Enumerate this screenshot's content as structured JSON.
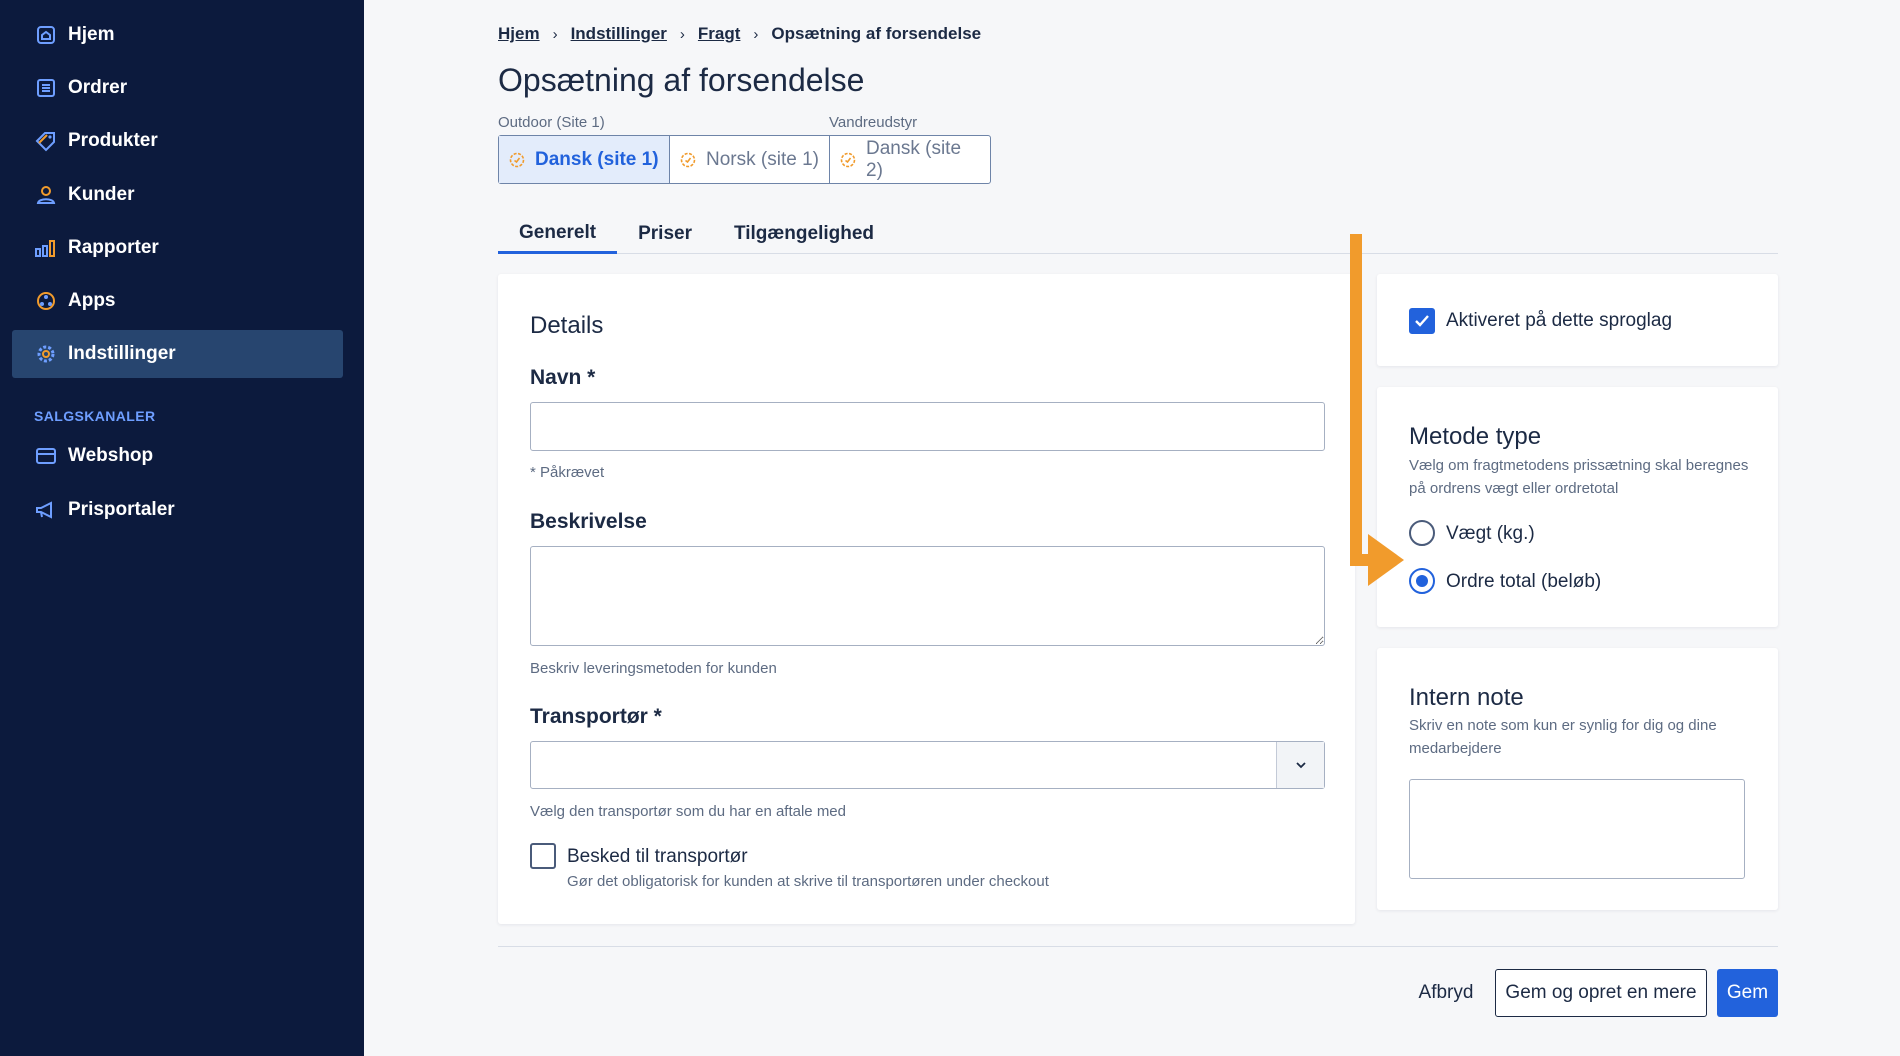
{
  "sidebar": {
    "items": [
      {
        "label": "Hjem",
        "icon": "home-icon"
      },
      {
        "label": "Ordrer",
        "icon": "orders-icon"
      },
      {
        "label": "Produkter",
        "icon": "tag-icon"
      },
      {
        "label": "Kunder",
        "icon": "user-icon"
      },
      {
        "label": "Rapporter",
        "icon": "bar-chart-icon"
      },
      {
        "label": "Apps",
        "icon": "apps-icon"
      },
      {
        "label": "Indstillinger",
        "icon": "gear-icon",
        "active": true
      }
    ],
    "section_label": "SALGSKANALER",
    "channels": [
      {
        "label": "Webshop",
        "icon": "webshop-icon"
      },
      {
        "label": "Prisportaler",
        "icon": "megaphone-icon"
      }
    ]
  },
  "breadcrumb": {
    "items": [
      "Hjem",
      "Indstillinger",
      "Fragt"
    ],
    "current": "Opsætning af forsendelse"
  },
  "page": {
    "title": "Opsætning af forsendelse"
  },
  "sites": {
    "labels": [
      "Outdoor (Site 1)",
      "Vandreudstyr"
    ],
    "tabs": [
      {
        "label": "Dansk (site 1)",
        "active": true
      },
      {
        "label": "Norsk (site 1)",
        "active": false
      },
      {
        "label": "Dansk (site 2)",
        "active": false
      }
    ]
  },
  "section_tabs": [
    {
      "label": "Generelt",
      "active": true
    },
    {
      "label": "Priser",
      "active": false
    },
    {
      "label": "Tilgængelighed",
      "active": false
    }
  ],
  "details": {
    "title": "Details",
    "name_label": "Navn *",
    "name_value": "",
    "name_help": "* Påkrævet",
    "description_label": "Beskrivelse",
    "description_value": "",
    "description_help": "Beskriv leveringsmetoden for kunden",
    "carrier_label": "Transportør *",
    "carrier_value": "",
    "carrier_help": "Vælg den transportør som du har en aftale med",
    "message_label": "Besked til transportør",
    "message_checked": false,
    "message_help": "Gør det obligatorisk for kunden at skrive til transportøren under checkout"
  },
  "activation": {
    "label": "Aktiveret på dette sproglag",
    "checked": true
  },
  "method_type": {
    "title": "Metode type",
    "description": "Vælg om fragtmetodens prissætning skal beregnes på ordrens vægt eller ordretotal",
    "options": [
      {
        "label": "Vægt (kg.)",
        "selected": false
      },
      {
        "label": "Ordre total (beløb)",
        "selected": true
      }
    ]
  },
  "internal_note": {
    "title": "Intern note",
    "description": "Skriv en note som kun er synlig for dig og dine medarbejdere",
    "value": ""
  },
  "footer": {
    "cancel_label": "Afbryd",
    "save_and_new_label": "Gem og opret en mere",
    "save_label": "Gem"
  },
  "colors": {
    "sidebar_bg": "#0c1a3d",
    "sidebar_active": "#27456f",
    "accent": "#2262dc",
    "annotation_arrow": "#f19b2c",
    "page_bg": "#f6f7f9"
  }
}
